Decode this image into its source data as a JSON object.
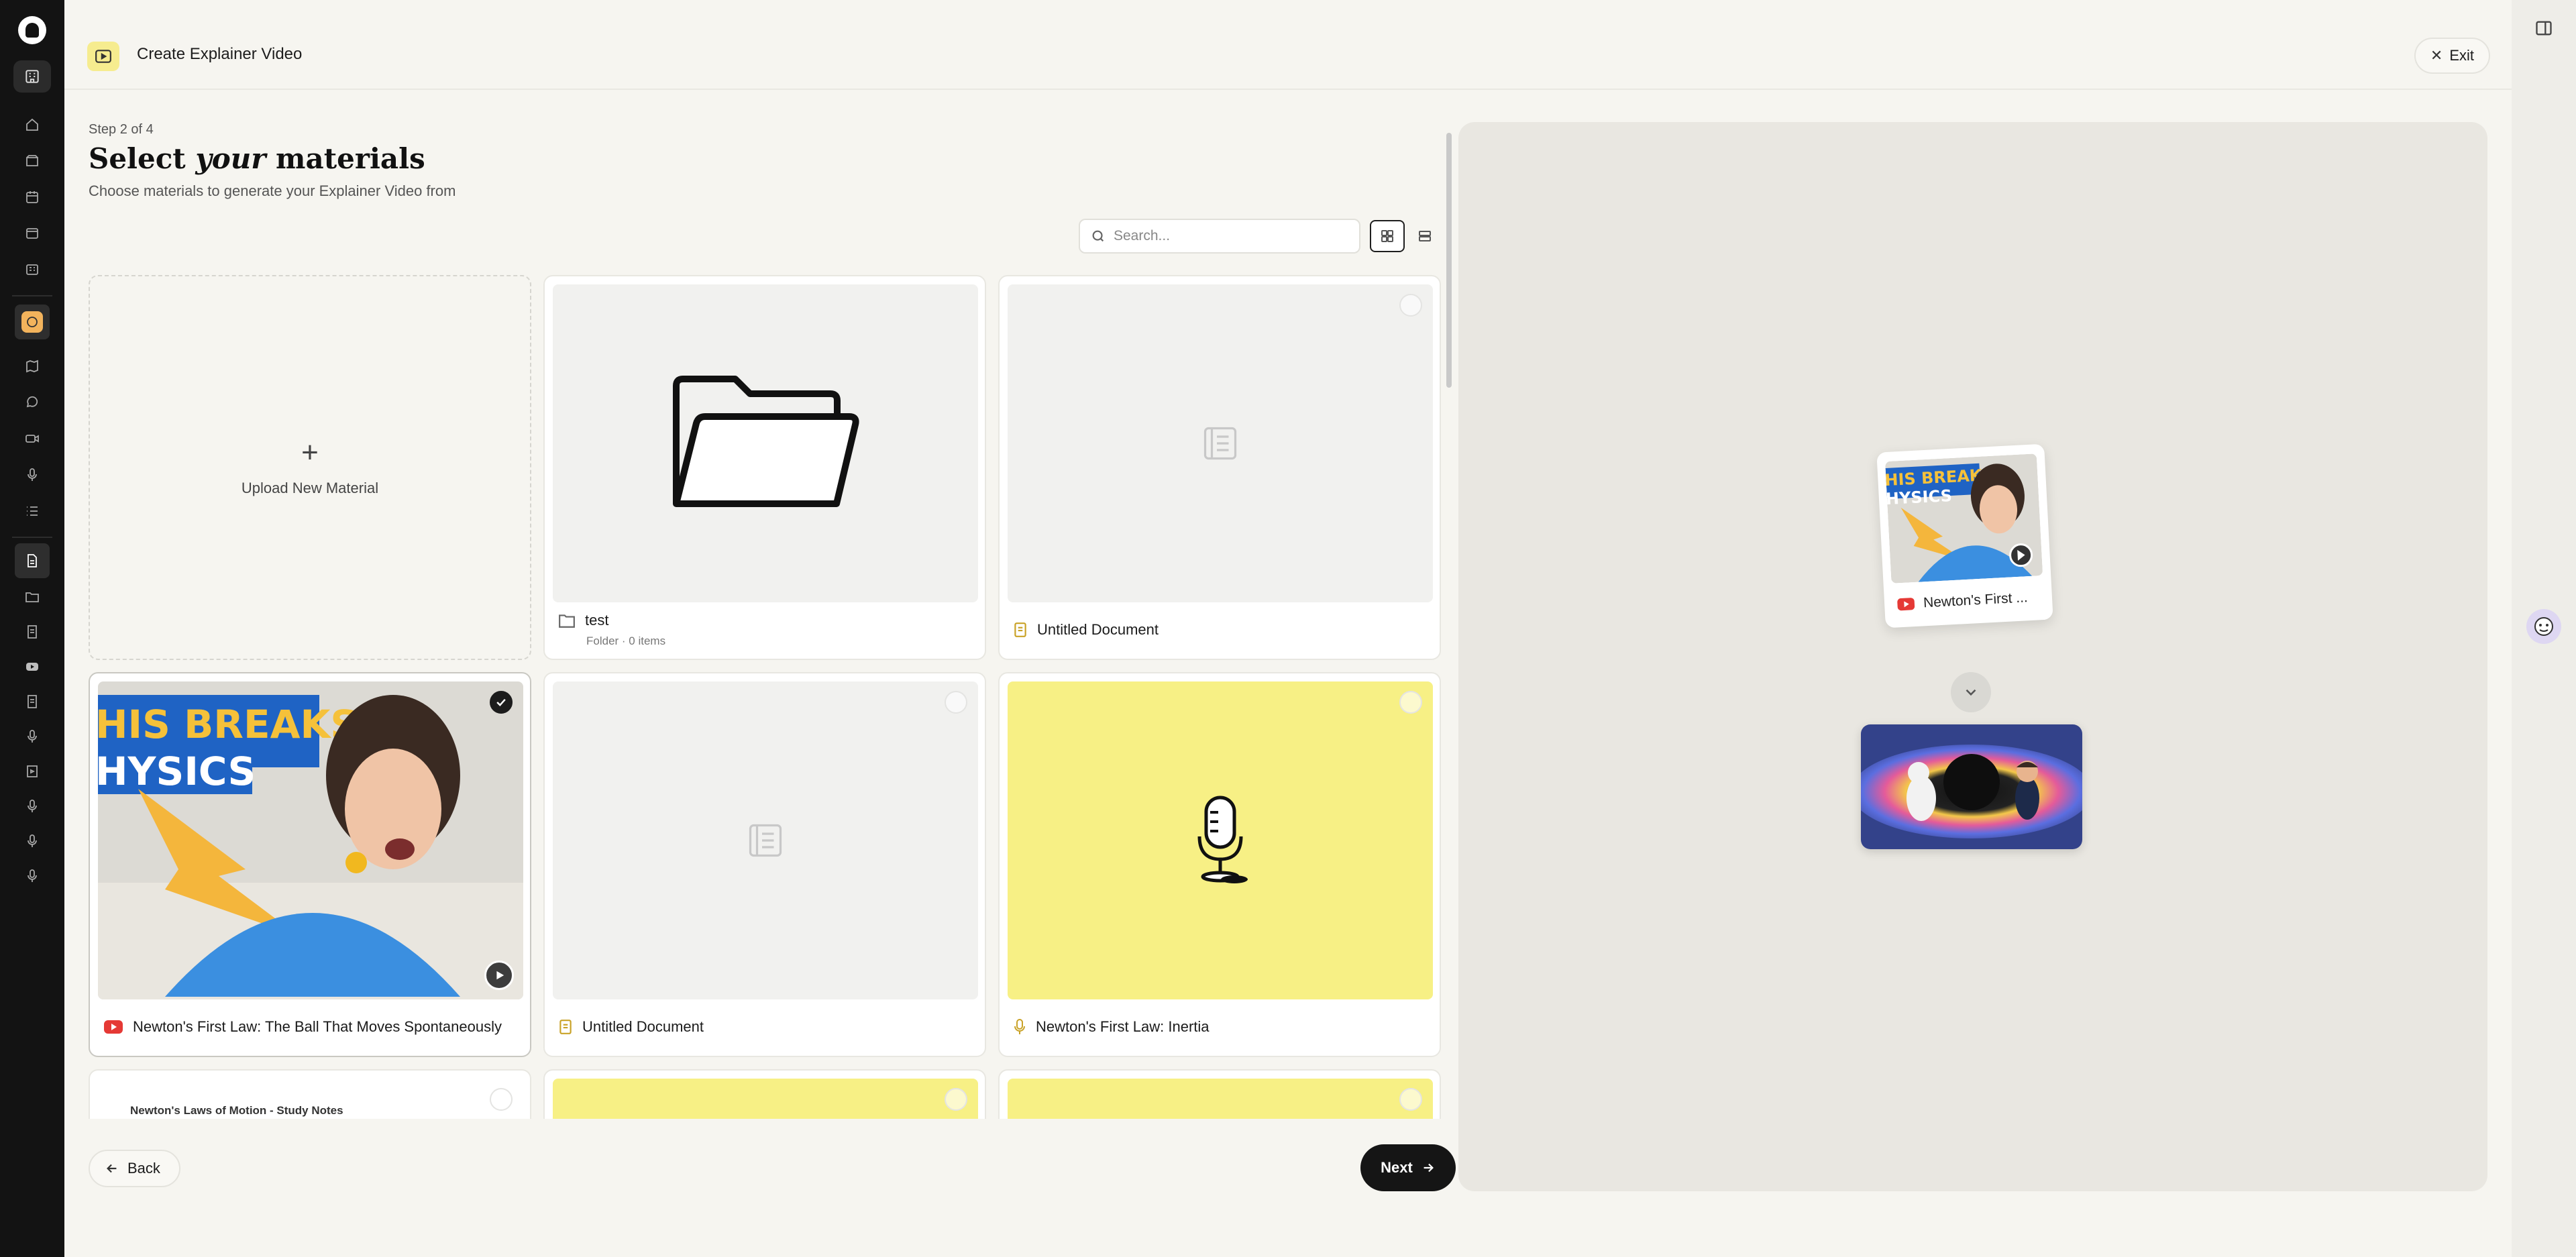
{
  "app": {
    "title": "Create Explainer Video",
    "exit_label": "Exit"
  },
  "sidebar": {
    "items": [
      "home-icon",
      "inbox-icon",
      "calendar-icon",
      "window-icon",
      "dashboard-icon",
      "avatar-app-icon",
      "map-icon",
      "chat-icon",
      "camera-icon",
      "mic-icon",
      "list-icon",
      "document-active-icon",
      "folder-icon",
      "doc-icon",
      "youtube-icon",
      "doc-icon",
      "mic-icon",
      "video-doc-icon",
      "mic-icon",
      "mic-icon",
      "mic-icon"
    ]
  },
  "wizard": {
    "step": "Step 2 of 4",
    "title_pre": "Select ",
    "title_em": "your",
    "title_post": " materials",
    "subtitle": "Choose materials to generate your Explainer Video from"
  },
  "search": {
    "placeholder": "Search..."
  },
  "upload": {
    "label": "Upload New Material",
    "plus": "+"
  },
  "materials": [
    {
      "type": "folder",
      "title": "test",
      "subtitle": "Folder · 0 items"
    },
    {
      "type": "document",
      "title": "Untitled Document",
      "selected": false
    },
    {
      "type": "youtube",
      "title": "Newton's First Law: The Ball That Moves Spontaneously",
      "selected": true,
      "thumb_text_1": "HIS BREAKS",
      "thumb_text_2": "HYSICS"
    },
    {
      "type": "document",
      "title": "Untitled Document",
      "selected": false
    },
    {
      "type": "audio",
      "title": "Newton's First Law: Inertia",
      "selected": false
    },
    {
      "type": "document",
      "title": "Newton's Laws of Motion - Study Notes",
      "selected": false
    }
  ],
  "footer": {
    "back_label": "Back",
    "next_label": "Next"
  },
  "preview": {
    "source_title": "Newton's First ...",
    "thumb_text_1": "HIS BREAKS",
    "thumb_text_2": "HYSICS"
  },
  "colors": {
    "accent_yellow": "#f7f085",
    "youtube_red": "#e53935",
    "doc_gold": "#c9a227",
    "primary_dark": "#151515"
  }
}
